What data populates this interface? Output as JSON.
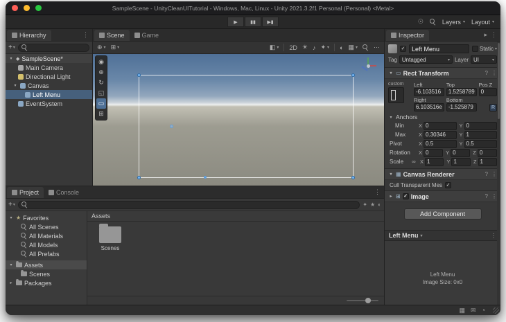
{
  "window": {
    "title": "SampleScene - UnityCleanUITutorial - Windows, Mac, Linux - Unity 2021.3.2f1 Personal (Personal) <Metal>"
  },
  "toolbar": {
    "layers": "Layers",
    "layout": "Layout"
  },
  "icons": {
    "play": "▶",
    "pause": "▮▮",
    "step": "▶▮",
    "dropdown": "▾",
    "foldout_open": "▾",
    "foldout_closed": "▸",
    "menu": "⋮",
    "more": "⋯",
    "check": "✓",
    "star": "★",
    "plus": "+",
    "help": "?",
    "link": "∞",
    "unity": "◆",
    "tool_view": "◉",
    "tool_move": "⊕",
    "tool_rotate": "↻",
    "tool_scale": "◱",
    "tool_rect": "▭",
    "tool_transform": "⊞",
    "pivot": "⊕",
    "axis_mode": "⊞",
    "shading": "◧",
    "sun": "☀",
    "audio": "♪",
    "fx": "✦",
    "visibility": "◐",
    "grid": "▦",
    "account": "☉",
    "mail": "✉",
    "activity": "◔"
  },
  "hierarchy": {
    "tab": "Hierarchy",
    "scene_row": "SampleScene*",
    "items": [
      {
        "label": "Main Camera"
      },
      {
        "label": "Directional Light"
      },
      {
        "label": "Canvas"
      },
      {
        "label": "Left Menu"
      },
      {
        "label": "EventSystem"
      }
    ]
  },
  "scene_view": {
    "tabs": [
      "Scene",
      "Game"
    ],
    "mode_2d": "2D"
  },
  "project": {
    "tabs": [
      "Project",
      "Console"
    ],
    "favorites_label": "Favorites",
    "favorites": [
      "All Scenes",
      "All Materials",
      "All Models",
      "All Prefabs"
    ],
    "assets_label": "Assets",
    "assets_children": [
      "Scenes"
    ],
    "packages_label": "Packages",
    "breadcrumb": "Assets",
    "folder_label": "Scenes"
  },
  "inspector": {
    "tab": "Inspector",
    "name": "Left Menu",
    "static_label": "Static",
    "tag_label": "Tag",
    "tag_value": "Untagged",
    "layer_label": "Layer",
    "layer_value": "UI",
    "rect_transform": {
      "title": "Rect Transform",
      "anchor_mode": "custom",
      "x_label": "X",
      "y_label": "Y",
      "z_label": "Z",
      "left_label": "Left",
      "left": "-6.103516",
      "top_label": "Top",
      "top": "1.5258789",
      "posz_label": "Pos Z",
      "posz": "0",
      "right_label": "Right",
      "right": "6.103516e",
      "bottom_label": "Bottom",
      "bottom": "-1.525879",
      "r_button": "R",
      "anchors_label": "Anchors",
      "min_label": "Min",
      "min_x": "0",
      "min_y": "0",
      "max_label": "Max",
      "max_x": "0.30346",
      "max_y": "1",
      "pivot_label": "Pivot",
      "pivot_x": "0.5",
      "pivot_y": "0.5",
      "rotation_label": "Rotation",
      "rot_x": "0",
      "rot_y": "0",
      "rot_z": "0",
      "scale_label": "Scale",
      "scale_x": "1",
      "scale_y": "1",
      "scale_z": "1"
    },
    "canvas_renderer": {
      "title": "Canvas Renderer",
      "cull_label": "Cull Transparent Mes"
    },
    "image": {
      "title": "Image"
    },
    "add_component": "Add Component",
    "preview": {
      "header": "Left Menu",
      "caption_name": "Left Menu",
      "caption_size": "Image Size: 0x0"
    }
  },
  "colors": {
    "selection": "#46607c",
    "handle_blue": "#7ab8f5",
    "play_accent": "#3a3a3a"
  }
}
